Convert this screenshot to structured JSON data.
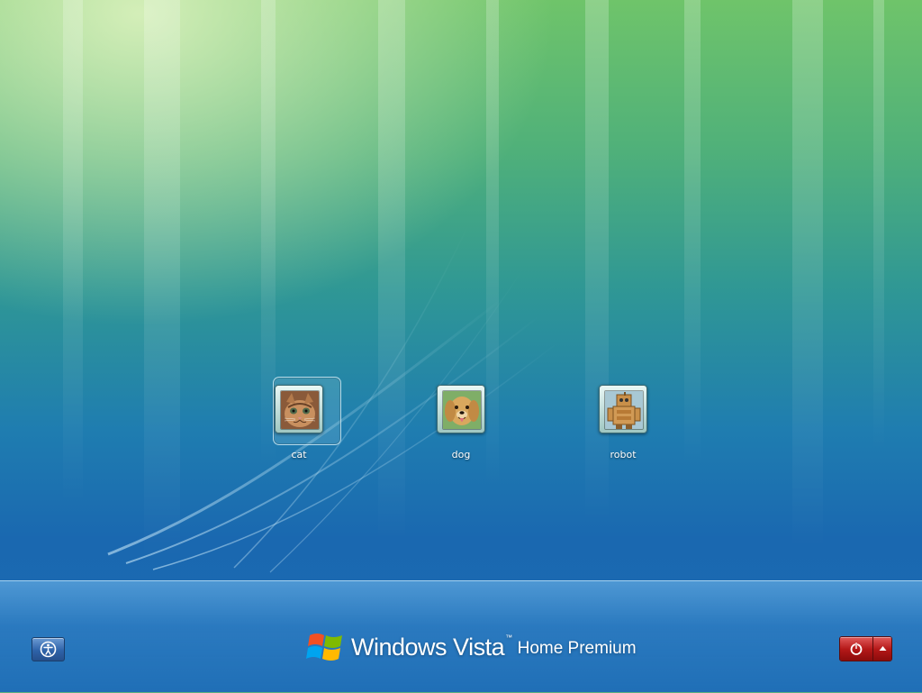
{
  "users": [
    {
      "name": "cat",
      "picture": "kitten-photo",
      "selected": true
    },
    {
      "name": "dog",
      "picture": "golden-retriever-photo",
      "selected": false
    },
    {
      "name": "robot",
      "picture": "toy-robot-photo",
      "selected": false
    }
  ],
  "branding": {
    "windows": "Windows",
    "vista": "Vista",
    "trademark": "™",
    "edition": "Home Premium"
  },
  "controls": {
    "ease_of_access_icon": "ease-of-access-icon",
    "power_icon": "power-icon",
    "power_options_icon": "triangle-up-icon"
  },
  "colors": {
    "background_top": "#6fc46a",
    "background_bottom": "#1d6cb4",
    "power_button": "#b41818",
    "ease_button": "#2f63a9"
  }
}
